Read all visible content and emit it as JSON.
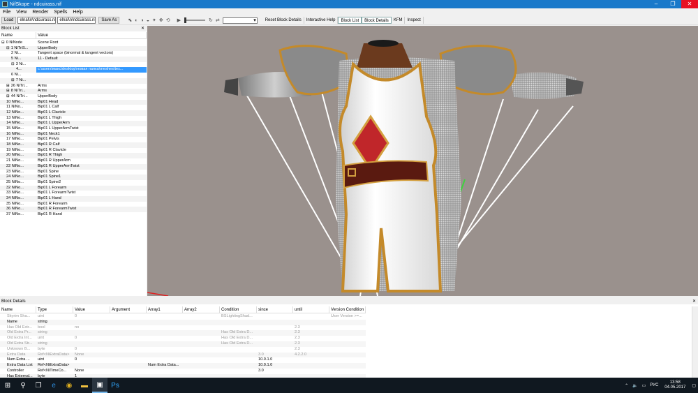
{
  "window": {
    "title": "NifSkope - ndcuirass.nif",
    "min": "–",
    "max": "❐",
    "close": "✕"
  },
  "menu": [
    "File",
    "View",
    "Render",
    "Spells",
    "Help"
  ],
  "toolbar": {
    "load": "Load",
    "load_path": "elnal\\n\\ndcuirass.nif",
    "save_path": "elnal\\n\\ndcuirass.nif",
    "save_as": "Save As",
    "reset_block_details": "Reset Block Details",
    "interactive_help": "Interactive Help",
    "block_list": "Block List",
    "block_details": "Block Details",
    "kfm": "KFM",
    "inspect": "Inspect"
  },
  "blocklist": {
    "title": "Block List",
    "close": "✕",
    "headers": [
      "Name",
      "Value"
    ],
    "rows": [
      {
        "name": "0 NiNode",
        "value": "Scene Root",
        "indent": 0,
        "exp": "⊟"
      },
      {
        "name": "1 NiTriS...",
        "value": "UpperBody",
        "indent": 1,
        "exp": "⊟"
      },
      {
        "name": "2 Ni...",
        "value": "Tangent space (binormal & tangent vectors)",
        "indent": 2,
        "exp": ""
      },
      {
        "name": "5 Ni...",
        "value": "11 - Default",
        "indent": 2,
        "exp": ""
      },
      {
        "name": "3 Ni...",
        "value": "",
        "indent": 2,
        "exp": "⊟"
      },
      {
        "name": "4...",
        "value": "c:\\users\\макс\\desktop\\новая папка\\meshes\\tex...",
        "indent": 3,
        "exp": "",
        "sel": true
      },
      {
        "name": "6 Ni...",
        "value": "",
        "indent": 2,
        "exp": ""
      },
      {
        "name": "7 Ni...",
        "value": "",
        "indent": 2,
        "exp": "⊞"
      },
      {
        "name": "26 NiTri...",
        "value": "Arms",
        "indent": 1,
        "exp": "⊞"
      },
      {
        "name": "8 NiTri...",
        "value": "Arms",
        "indent": 1,
        "exp": "⊞"
      },
      {
        "name": "44 NiTri...",
        "value": "UpperBody",
        "indent": 1,
        "exp": "⊞"
      },
      {
        "name": "10 NiNo...",
        "value": "Bip01 Head",
        "indent": 1,
        "exp": ""
      },
      {
        "name": "11 NiNo...",
        "value": "Bip01 L Calf",
        "indent": 1,
        "exp": ""
      },
      {
        "name": "12 NiNo...",
        "value": "Bip01 L Clavicle",
        "indent": 1,
        "exp": ""
      },
      {
        "name": "13 NiNo...",
        "value": "Bip01 L Thigh",
        "indent": 1,
        "exp": ""
      },
      {
        "name": "14 NiNo...",
        "value": "Bip01 L UpperArm",
        "indent": 1,
        "exp": ""
      },
      {
        "name": "15 NiNo...",
        "value": "Bip01 L UpperArmTwist",
        "indent": 1,
        "exp": ""
      },
      {
        "name": "16 NiNo...",
        "value": "Bip01 Neck1",
        "indent": 1,
        "exp": ""
      },
      {
        "name": "17 NiNo...",
        "value": "Bip01 Pelvis",
        "indent": 1,
        "exp": ""
      },
      {
        "name": "18 NiNo...",
        "value": "Bip01 R Calf",
        "indent": 1,
        "exp": ""
      },
      {
        "name": "19 NiNo...",
        "value": "Bip01 R Clavicle",
        "indent": 1,
        "exp": ""
      },
      {
        "name": "20 NiNo...",
        "value": "Bip01 R Thigh",
        "indent": 1,
        "exp": ""
      },
      {
        "name": "21 NiNo...",
        "value": "Bip01 R UpperArm",
        "indent": 1,
        "exp": ""
      },
      {
        "name": "22 NiNo...",
        "value": "Bip01 R UpperArmTwist",
        "indent": 1,
        "exp": ""
      },
      {
        "name": "23 NiNo...",
        "value": "Bip01 Spine",
        "indent": 1,
        "exp": ""
      },
      {
        "name": "24 NiNo...",
        "value": "Bip01 Spine1",
        "indent": 1,
        "exp": ""
      },
      {
        "name": "25 NiNo...",
        "value": "Bip01 Spine2",
        "indent": 1,
        "exp": ""
      },
      {
        "name": "32 NiNo...",
        "value": "Bip01 L Forearm",
        "indent": 1,
        "exp": ""
      },
      {
        "name": "33 NiNo...",
        "value": "Bip01 L ForearmTwist",
        "indent": 1,
        "exp": ""
      },
      {
        "name": "34 NiNo...",
        "value": "Bip01 L Hand",
        "indent": 1,
        "exp": ""
      },
      {
        "name": "35 NiNo...",
        "value": "Bip01 R Forearm",
        "indent": 1,
        "exp": ""
      },
      {
        "name": "36 NiNo...",
        "value": "Bip01 R ForearmTwist",
        "indent": 1,
        "exp": ""
      },
      {
        "name": "37 NiNo...",
        "value": "Bip01 R Hand",
        "indent": 1,
        "exp": ""
      }
    ]
  },
  "details": {
    "title": "Block Details",
    "close": "✕",
    "headers": [
      "Name",
      "Type",
      "Value",
      "Argument",
      "Array1",
      "Array2",
      "Condition",
      "since",
      "until",
      "Version Condition"
    ],
    "rows": [
      {
        "cells": [
          "Skyrim Sha...",
          "uint",
          "0",
          "",
          "",
          "",
          "BSLightingShad...",
          "",
          "",
          "User Version >=..."
        ],
        "dim": true
      },
      {
        "cells": [
          "Name",
          "string",
          "",
          "",
          "",
          "",
          "",
          "",
          "",
          ""
        ],
        "dim": false
      },
      {
        "cells": [
          "Has Old Extr...",
          "bool",
          "no",
          "",
          "",
          "",
          "",
          "",
          "2.3",
          ""
        ],
        "dim": true
      },
      {
        "cells": [
          "Old Extra Pr...",
          "string",
          "",
          "",
          "",
          "",
          "Has Old Extra D...",
          "",
          "2.3",
          ""
        ],
        "dim": true
      },
      {
        "cells": [
          "Old Extra Int...",
          "uint",
          "0",
          "",
          "",
          "",
          "Has Old Extra D...",
          "",
          "2.3",
          ""
        ],
        "dim": true
      },
      {
        "cells": [
          "Old Extra Str...",
          "string",
          "",
          "",
          "",
          "",
          "Has Old Extra D...",
          "",
          "2.3",
          ""
        ],
        "dim": true
      },
      {
        "cells": [
          "Unknown B...",
          "byte",
          "0",
          "",
          "",
          "",
          "",
          "",
          "2.3",
          ""
        ],
        "dim": true
      },
      {
        "cells": [
          "Extra Data",
          "Ref<NiExtraData>",
          "None",
          "",
          "",
          "",
          "",
          "3.0",
          "4.2.2.0",
          ""
        ],
        "dim": true
      },
      {
        "cells": [
          "Num Extra ...",
          "uint",
          "0",
          "",
          "",
          "",
          "",
          "10.0.1.0",
          "",
          ""
        ],
        "dim": false
      },
      {
        "cells": [
          "Extra Data List",
          "Ref<NiExtraData>",
          "",
          "",
          "Num Extra Data...",
          "",
          "",
          "10.0.1.0",
          "",
          ""
        ],
        "dim": false
      },
      {
        "cells": [
          "Controller",
          "Ref<NiTimeCo...",
          "None",
          "",
          "",
          "",
          "",
          "3.0",
          "",
          ""
        ],
        "dim": false
      },
      {
        "cells": [
          "Has External...",
          "byte",
          "1",
          "",
          "",
          "",
          "",
          "",
          "",
          ""
        ],
        "dim": false
      }
    ]
  },
  "taskbar": {
    "lang": "РУС",
    "time": "13:58",
    "date": "04.05.2017"
  },
  "colors": {
    "titlebar": "#1979ca",
    "selection": "#3399ff",
    "viewport": "#9a918d"
  }
}
